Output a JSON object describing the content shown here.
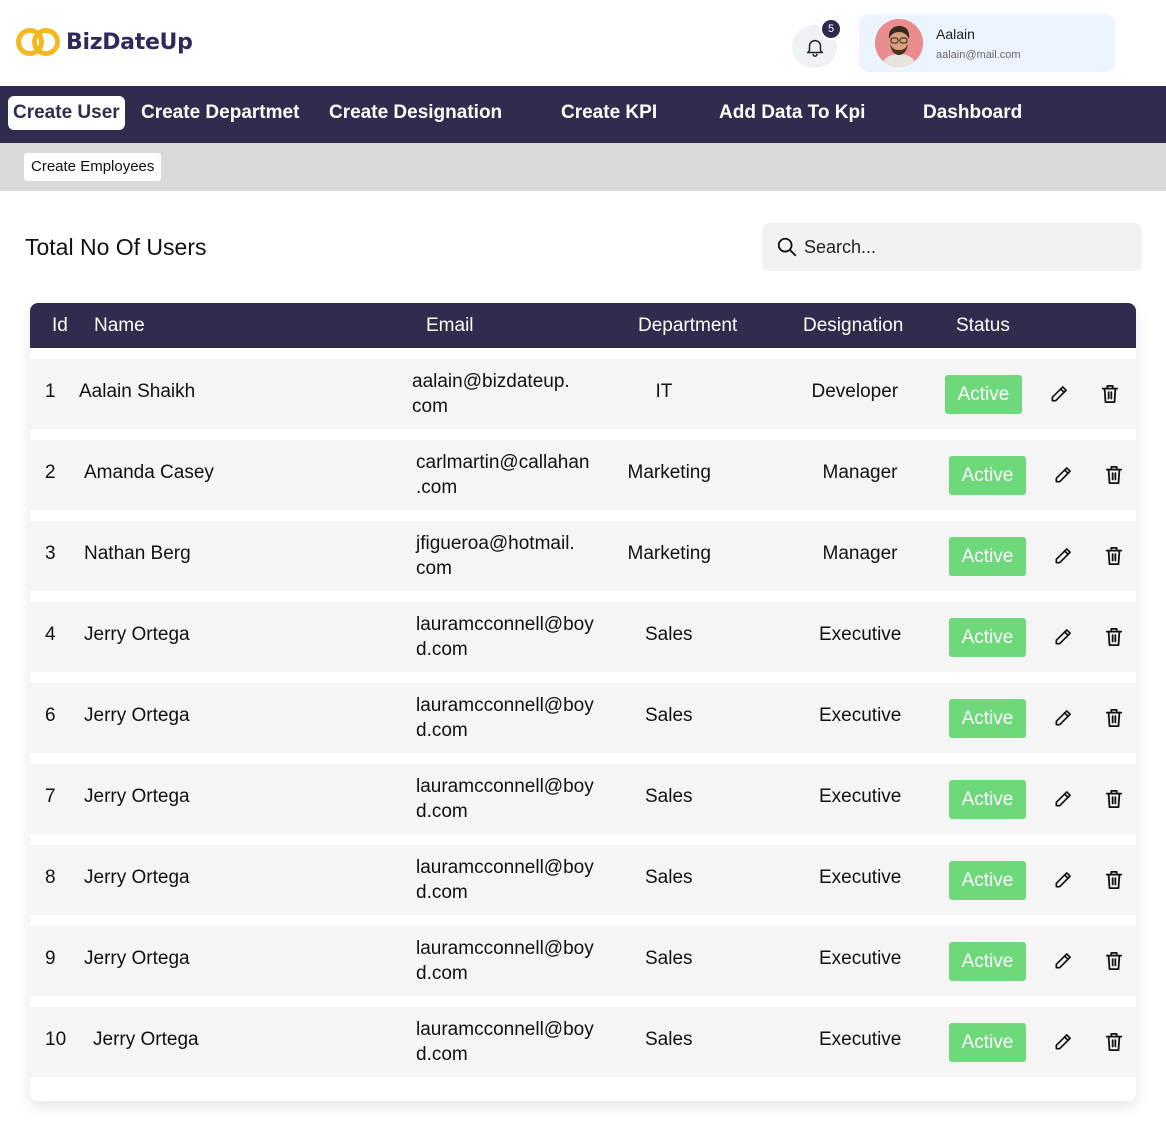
{
  "brand": {
    "name": "BizDateUp"
  },
  "notifications": {
    "count": "5"
  },
  "profile": {
    "name": "Aalain",
    "email": "aalain@mail.com"
  },
  "nav": {
    "items": [
      {
        "label": "Create User",
        "active": true
      },
      {
        "label": "Create Departmet"
      },
      {
        "label": "Create Designation"
      },
      {
        "label": "Create KPI"
      },
      {
        "label": "Add Data To Kpi"
      },
      {
        "label": "Dashboard"
      }
    ]
  },
  "subnav": {
    "label": "Create Employees"
  },
  "page": {
    "title": "Total No Of Users"
  },
  "search": {
    "placeholder": "Search..."
  },
  "table": {
    "headers": {
      "id": "Id",
      "name": "Name",
      "email": "Email",
      "department": "Department",
      "designation": "Designation",
      "status": "Status"
    },
    "rows": [
      {
        "id": "1",
        "name": "Aalain Shaikh",
        "email_line1": "aalain@bizdateup.",
        "email_line2": "com",
        "department": "IT",
        "designation": "Developer",
        "status": "Active"
      },
      {
        "id": "2",
        "name": "Amanda Casey",
        "email_line1": "carlmartin@callahan",
        "email_line2": ".com",
        "department": "Marketing",
        "designation": "Manager",
        "status": "Active"
      },
      {
        "id": "3",
        "name": "Nathan Berg",
        "email_line1": "jfigueroa@hotmail.",
        "email_line2": "com",
        "department": "Marketing",
        "designation": "Manager",
        "status": "Active"
      },
      {
        "id": "4",
        "name": "Jerry Ortega",
        "email_line1": "lauramcconnell@boy",
        "email_line2": "d.com",
        "department": "Sales",
        "designation": "Executive",
        "status": "Active"
      },
      {
        "id": "6",
        "name": "Jerry Ortega",
        "email_line1": "lauramcconnell@boy",
        "email_line2": "d.com",
        "department": "Sales",
        "designation": "Executive",
        "status": "Active"
      },
      {
        "id": "7",
        "name": "Jerry Ortega",
        "email_line1": "lauramcconnell@boy",
        "email_line2": "d.com",
        "department": "Sales",
        "designation": "Executive",
        "status": "Active"
      },
      {
        "id": "8",
        "name": "Jerry Ortega",
        "email_line1": "lauramcconnell@boy",
        "email_line2": "d.com",
        "department": "Sales",
        "designation": "Executive",
        "status": "Active"
      },
      {
        "id": "9",
        "name": "Jerry Ortega",
        "email_line1": "lauramcconnell@boy",
        "email_line2": "d.com",
        "department": "Sales",
        "designation": "Executive",
        "status": "Active"
      },
      {
        "id": "10",
        "name": "Jerry Ortega",
        "email_line1": "lauramcconnell@boy",
        "email_line2": "d.com",
        "department": "Sales",
        "designation": "Executive",
        "status": "Active"
      }
    ]
  },
  "colors": {
    "navy": "#2e2d4d",
    "status_active": "#6ed97a",
    "logo_gold": "#f3b71f",
    "row_bg": "#f5f5f5"
  },
  "icons": {
    "notification": "bell-icon",
    "search": "search-icon",
    "edit": "pencil-icon",
    "delete": "trash-icon"
  }
}
